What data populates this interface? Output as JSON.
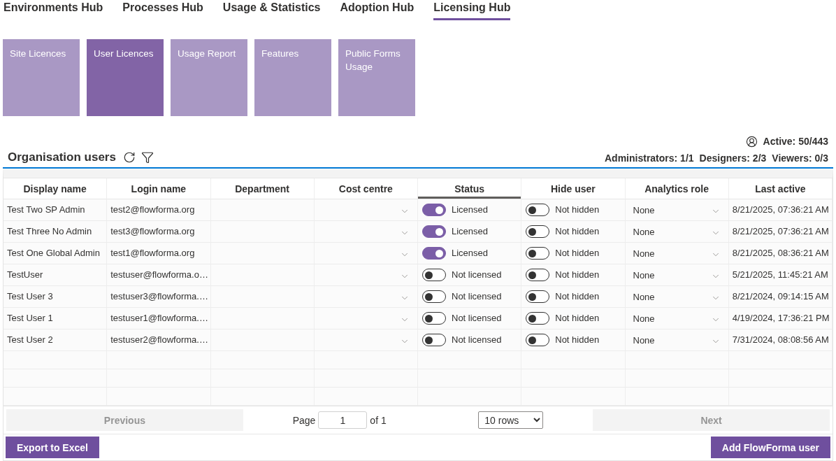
{
  "nav_tabs": [
    {
      "label": "Environments Hub",
      "selected": false
    },
    {
      "label": "Processes Hub",
      "selected": false
    },
    {
      "label": "Usage & Statistics",
      "selected": false
    },
    {
      "label": "Adoption Hub",
      "selected": false
    },
    {
      "label": "Licensing Hub",
      "selected": true
    }
  ],
  "tiles": [
    {
      "label": "Site Licences",
      "selected": false
    },
    {
      "label": "User Licences",
      "selected": true
    },
    {
      "label": "Usage Report",
      "selected": false
    },
    {
      "label": "Features",
      "selected": false
    },
    {
      "label": "Public Forms Usage",
      "selected": false
    }
  ],
  "summary": {
    "active": "Active: 50/443",
    "counts": [
      "Administrators: 1/1",
      "Designers: 2/3",
      "Viewers: 0/3"
    ]
  },
  "users_panel": {
    "title": "Organisation users"
  },
  "table": {
    "columns": [
      {
        "label": "Display name",
        "selected": false
      },
      {
        "label": "Login name",
        "selected": false
      },
      {
        "label": "Department",
        "selected": false
      },
      {
        "label": "Cost centre",
        "selected": false
      },
      {
        "label": "Status",
        "selected": true
      },
      {
        "label": "Hide user",
        "selected": false
      },
      {
        "label": "Analytics role",
        "selected": false
      },
      {
        "label": "Last active",
        "selected": false
      }
    ],
    "rows": [
      {
        "display_name": "Test Two SP Admin",
        "login_name": "test2@flowforma.org",
        "status": {
          "on": true,
          "label": "Licensed"
        },
        "hide_user": {
          "on": false,
          "label": "Not hidden"
        },
        "analytics_role": "None",
        "last_active": "8/21/2025, 07:36:21 AM"
      },
      {
        "display_name": "Test Three No Admin",
        "login_name": "test3@flowforma.org",
        "status": {
          "on": true,
          "label": "Licensed"
        },
        "hide_user": {
          "on": false,
          "label": "Not hidden"
        },
        "analytics_role": "None",
        "last_active": "8/21/2025, 07:36:21 AM"
      },
      {
        "display_name": "Test One Global Admin",
        "login_name": "test1@flowforma.org",
        "status": {
          "on": true,
          "label": "Licensed"
        },
        "hide_user": {
          "on": false,
          "label": "Not hidden"
        },
        "analytics_role": "None",
        "last_active": "8/21/2025, 08:36:21 AM"
      },
      {
        "display_name": "TestUser",
        "login_name": "testuser@flowforma.o…",
        "status": {
          "on": false,
          "label": "Not licensed"
        },
        "hide_user": {
          "on": false,
          "label": "Not hidden"
        },
        "analytics_role": "None",
        "last_active": "5/21/2025, 11:45:21 AM"
      },
      {
        "display_name": "Test User 3",
        "login_name": "testuser3@flowforma.…",
        "status": {
          "on": false,
          "label": "Not licensed"
        },
        "hide_user": {
          "on": false,
          "label": "Not hidden"
        },
        "analytics_role": "None",
        "last_active": "8/21/2024, 09:14:15 AM"
      },
      {
        "display_name": "Test User 1",
        "login_name": "testuser1@flowforma.…",
        "status": {
          "on": false,
          "label": "Not licensed"
        },
        "hide_user": {
          "on": false,
          "label": "Not hidden"
        },
        "analytics_role": "None",
        "last_active": "4/19/2024, 17:36:21 PM"
      },
      {
        "display_name": "Test User 2",
        "login_name": "testuser2@flowforma.…",
        "status": {
          "on": false,
          "label": "Not licensed"
        },
        "hide_user": {
          "on": false,
          "label": "Not hidden"
        },
        "analytics_role": "None",
        "last_active": "7/31/2024, 08:08:56 AM"
      }
    ]
  },
  "pagination": {
    "previous": {
      "label": "Previous",
      "disabled": true
    },
    "page_label": "Page",
    "page": "1",
    "page_total": "of 1",
    "rows_select": "10 rows",
    "next": {
      "label": "Next",
      "disabled": true
    }
  },
  "buttons": [
    "Export to Excel",
    "Add FlowForma user"
  ]
}
